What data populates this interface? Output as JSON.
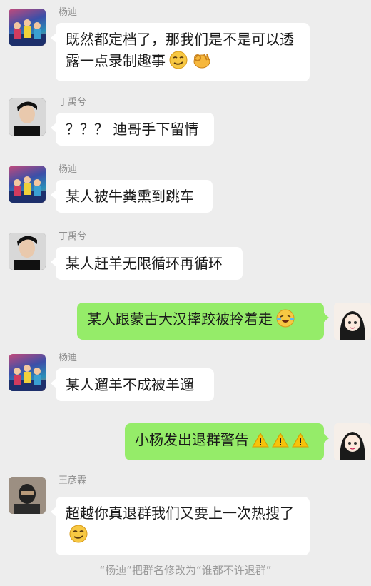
{
  "messages": [
    {
      "sender": "杨迪",
      "text": "既然都定档了，那我们是不是可以透露一点录制趣事",
      "emojis": [
        "smirk-face-icon",
        "ok-hand-icon"
      ]
    },
    {
      "sender": "丁禹兮",
      "text": "？？？ 迪哥手下留情"
    },
    {
      "sender": "杨迪",
      "text": "某人被牛粪熏到跳车"
    },
    {
      "sender": "丁禹兮",
      "text": "某人赶羊无限循环再循环"
    },
    {
      "sender": "me",
      "text": "某人跟蒙古大汉摔跤被拎着走",
      "emojis": [
        "laugh-cry-face-icon"
      ]
    },
    {
      "sender": "杨迪",
      "text": "某人遛羊不成被羊遛"
    },
    {
      "sender": "me",
      "text": "小杨发出退群警告",
      "emojis": [
        "warning-icon",
        "warning-icon",
        "warning-icon"
      ]
    },
    {
      "sender": "王彦霖",
      "text": "超越你真退群我们又要上一次热搜了",
      "emojis": [
        "smirk-face-icon"
      ]
    }
  ],
  "system_notice": "“杨迪”把群名修改为“谁都不许退群”",
  "colors": {
    "background": "#ededed",
    "bubble_in": "#ffffff",
    "bubble_out": "#95ec69",
    "sender_name": "#8e8e8e"
  }
}
